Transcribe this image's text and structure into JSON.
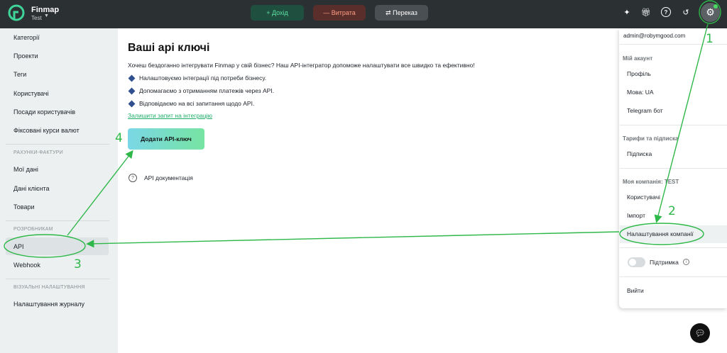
{
  "header": {
    "brand": "Finmap",
    "company": "Test",
    "buttons": {
      "income": "+ Дохід",
      "expense": "— Витрата",
      "transfer": "⇄ Переказ"
    },
    "icons": [
      "magic-wand-icon",
      "gift-icon",
      "help-icon",
      "history-icon",
      "settings-gear-icon"
    ]
  },
  "sidebar": {
    "items_top": [
      "Категорії",
      "Проекти",
      "Теги",
      "Користувачі",
      "Посади користувачів",
      "Фіксовані курси валют"
    ],
    "section_invoices": "РАХУНКИ-ФАКТУРИ",
    "items_invoices": [
      "Мої дані",
      "Дані клієнта",
      "Товари"
    ],
    "section_dev": "РОЗРОБНИКАМ",
    "items_dev": [
      "API",
      "Webhook"
    ],
    "section_visual": "ВІЗУАЛЬНІ НАЛАШТУВАННЯ",
    "items_visual": [
      "Налаштування журналу"
    ]
  },
  "main": {
    "title": "Ваші api ключі",
    "intro": "Хочеш бездоганно інтегрувати Finmap у свій бізнес? Наш API-інтегратор допоможе налаштувати все швидко та ефективно!",
    "bullets": [
      "Налаштовуємо інтеграції під потреби бізнесу.",
      "Допомагаємо з отриманням платежів через API.",
      "Відповідаємо на всі запитання щодо API."
    ],
    "link": "Залишити запит на інтеграцію",
    "add_button": "Додати API-ключ",
    "docs": "API документація"
  },
  "dropdown": {
    "email": "admin@robymgood.com",
    "account_header": "Мій акаунт",
    "account_items": [
      "Профіль",
      "Мова: UA",
      "Telegram бот"
    ],
    "plans_header": "Тарифи та підписка",
    "plans_items": [
      "Підписка"
    ],
    "company_header": "Моя компанія: TEST",
    "company_items": [
      "Користувачі",
      "Імпорт",
      "Налаштування компанії"
    ],
    "support": "Підтримка",
    "logout": "Вийти"
  },
  "annotations": [
    "1",
    "2",
    "3",
    "4"
  ],
  "colors": {
    "topbar": "#2b3033",
    "sidebar": "#ecf0f1",
    "annotation": "#2fb84a",
    "accent_green": "#1fae6a"
  }
}
